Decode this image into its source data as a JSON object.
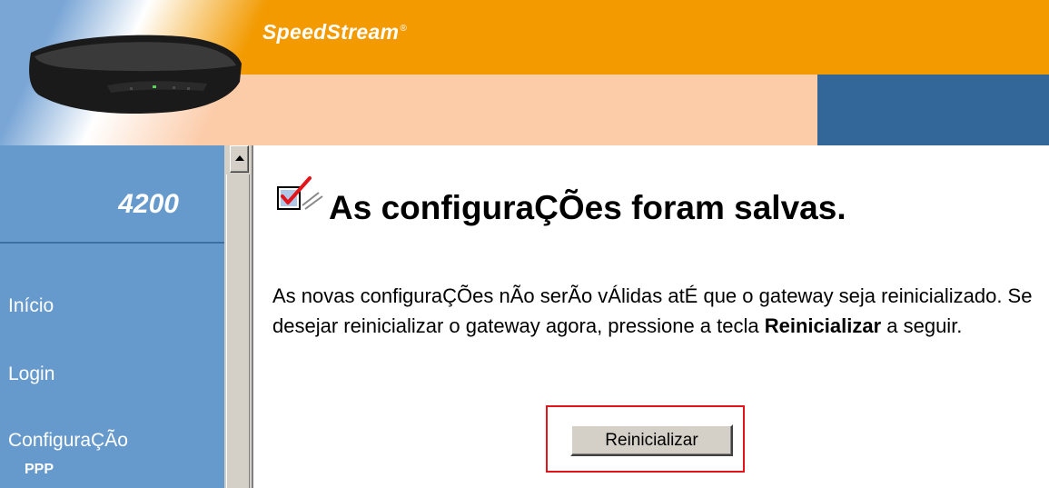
{
  "header": {
    "brand": "SpeedStream",
    "brand_mark": "®",
    "device_image": "dsl-modem-image"
  },
  "sidebar": {
    "model": "4200",
    "items": [
      {
        "label": "Início"
      },
      {
        "label": "Login"
      },
      {
        "label": "ConfiguraÇÃo"
      },
      {
        "label": "PPP"
      }
    ]
  },
  "main": {
    "icon": "checkbox-check-icon",
    "heading": "As configuraÇÕes foram salvas.",
    "message_part1": "As novas configuraÇÕes nÃo serÃo vÁlidas atÉ que o gateway seja reinicializado. Se desejar reinicializar o gateway agora, pressione a tecla ",
    "message_emphasis": "Reinicializar",
    "message_part2": " a seguir.",
    "reboot_button_label": "Reinicializar"
  },
  "colors": {
    "orange": "#f29a00",
    "peach": "#fccba8",
    "blue": "#336699",
    "sidebar": "#6699cc",
    "highlight_frame": "#e3151a"
  }
}
